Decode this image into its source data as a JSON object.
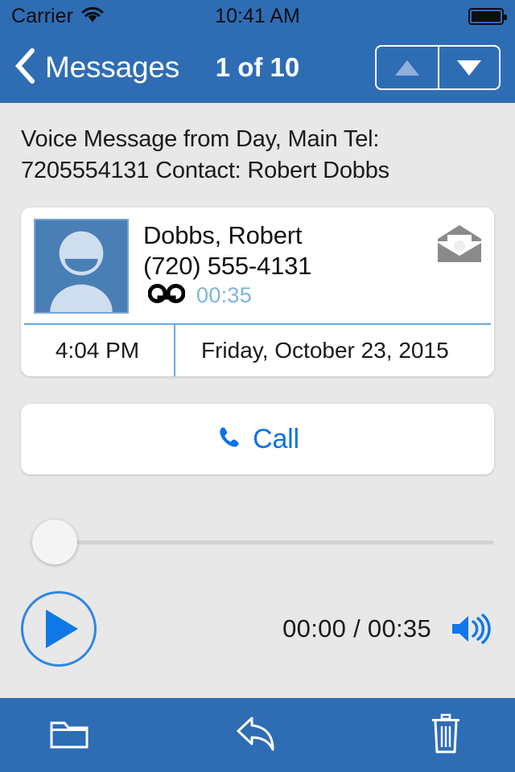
{
  "status_bar": {
    "carrier": "Carrier",
    "wifi_icon": "wifi-icon",
    "time": "10:41 AM",
    "battery_icon": "battery-full-icon"
  },
  "nav_bar": {
    "back_icon": "chevron-left-icon",
    "back_label": "Messages",
    "counter": "1 of 10",
    "prev_icon": "triangle-up-icon",
    "next_icon": "triangle-down-icon",
    "prev_enabled": false,
    "next_enabled": true
  },
  "message": {
    "subject": "Voice Message from Day, Main Tel: 7205554131 Contact: Robert Dobbs",
    "contact": {
      "avatar_icon": "person-avatar-icon",
      "name": "Dobbs, Robert",
      "phone": "(720) 555-4131",
      "voicemail_icon": "voicemail-tape-icon",
      "duration": "00:35",
      "status_icon": "open-envelope-icon",
      "time": "4:04 PM",
      "date": "Friday, October 23, 2015"
    }
  },
  "call_button": {
    "icon": "phone-handset-icon",
    "label": "Call"
  },
  "player": {
    "scrubber_position_percent": 0,
    "play_icon": "play-icon",
    "elapsed": "00:00",
    "separator": "/",
    "total": "00:35",
    "time_display": "00:00 / 00:35",
    "volume_icon": "speaker-volume-icon"
  },
  "toolbar": {
    "folder_icon": "folder-icon",
    "reply_icon": "reply-arrow-icon",
    "delete_icon": "trash-icon"
  },
  "colors": {
    "header_blue": "#2e6db4",
    "background_gray": "#e8e8e8",
    "accent_blue": "#0a72e8",
    "duration_blue": "#7db4e0",
    "divider_blue": "#6aaade",
    "avatar_blue": "#4a7fb5"
  }
}
